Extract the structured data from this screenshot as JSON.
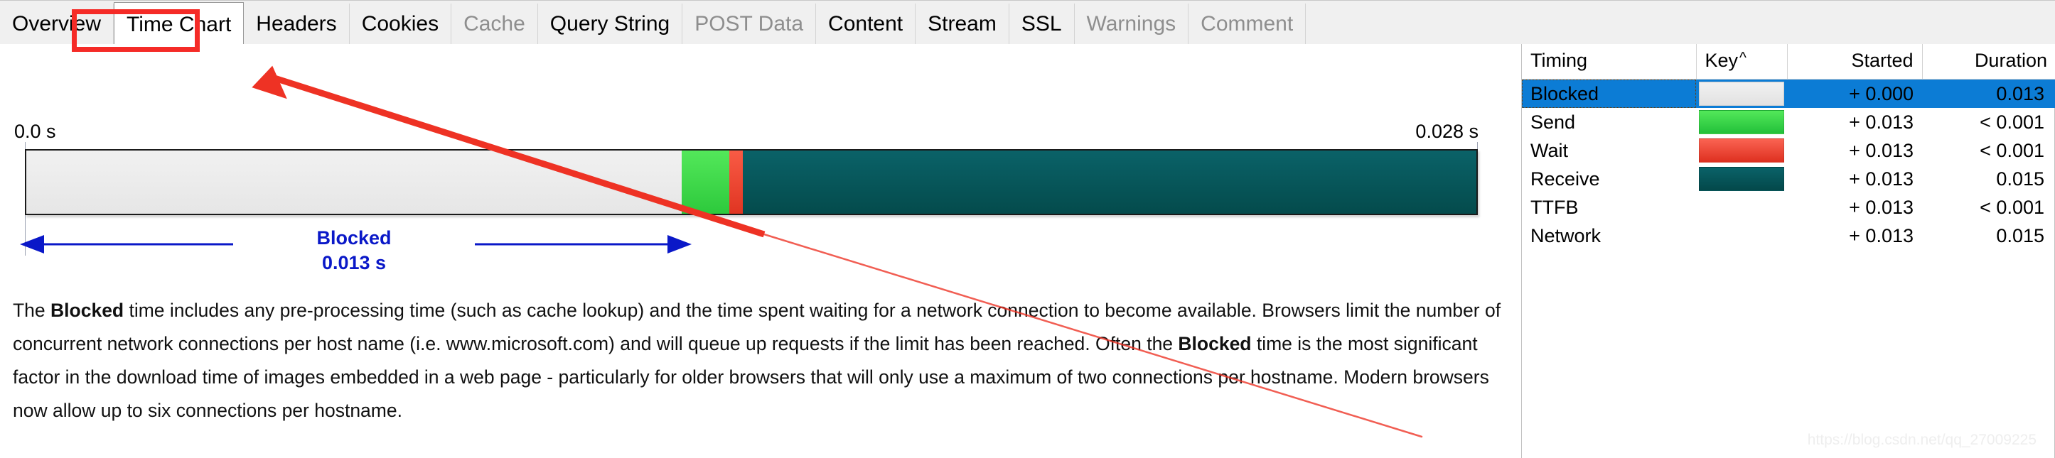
{
  "tabs": [
    {
      "label": "Overview",
      "selected": false,
      "disabled": false
    },
    {
      "label": "Time Chart",
      "selected": true,
      "disabled": false
    },
    {
      "label": "Headers",
      "selected": false,
      "disabled": false
    },
    {
      "label": "Cookies",
      "selected": false,
      "disabled": false
    },
    {
      "label": "Cache",
      "selected": false,
      "disabled": true
    },
    {
      "label": "Query String",
      "selected": false,
      "disabled": false
    },
    {
      "label": "POST Data",
      "selected": false,
      "disabled": true
    },
    {
      "label": "Content",
      "selected": false,
      "disabled": false
    },
    {
      "label": "Stream",
      "selected": false,
      "disabled": false
    },
    {
      "label": "SSL",
      "selected": false,
      "disabled": false
    },
    {
      "label": "Warnings",
      "selected": false,
      "disabled": true
    },
    {
      "label": "Comment",
      "selected": false,
      "disabled": true
    }
  ],
  "timeline": {
    "axis_start_label": "0.0 s",
    "axis_end_label": "0.028 s",
    "annotation": {
      "label": "Blocked",
      "value": "0.013 s",
      "color": "#0a18c8"
    },
    "segments": [
      {
        "name": "Blocked",
        "color": "#ebebeb",
        "percent": 45.2
      },
      {
        "name": "Send",
        "color": "#2dc93c",
        "percent": 3.3
      },
      {
        "name": "Wait",
        "color": "#e8412c",
        "percent": 0.9
      },
      {
        "name": "Receive",
        "color": "#055058",
        "percent": 50.6
      }
    ]
  },
  "description": {
    "part1": "The ",
    "bold1": "Blocked",
    "part2": " time includes any pre-processing time (such as cache lookup) and the time spent waiting for a network connection to become available. Browsers limit the number of concurrent network connections per host name (i.e. www.microsoft.com) and will queue up requests if the limit has been reached. Often the ",
    "bold2": "Blocked",
    "part3": " time is the most significant factor in the download time of images embedded in a web page - particularly for older browsers that will only use a maximum of two connections per hostname. Modern browsers now allow up to six connections per hostname."
  },
  "timing_table": {
    "columns": {
      "timing": "Timing",
      "key": "Key",
      "key_sort_caret": "^",
      "started": "Started",
      "duration": "Duration"
    },
    "rows": [
      {
        "timing": "Blocked",
        "swatch": "blocked",
        "started": "+ 0.000",
        "duration": "0.013",
        "selected": true
      },
      {
        "timing": "Send",
        "swatch": "send",
        "started": "+ 0.013",
        "duration": "< 0.001",
        "selected": false
      },
      {
        "timing": "Wait",
        "swatch": "wait",
        "started": "+ 0.013",
        "duration": "< 0.001",
        "selected": false
      },
      {
        "timing": "Receive",
        "swatch": "receive",
        "started": "+ 0.013",
        "duration": "0.015",
        "selected": false
      },
      {
        "timing": "TTFB",
        "swatch": "none",
        "started": "+ 0.013",
        "duration": "< 0.001",
        "selected": false
      },
      {
        "timing": "Network",
        "swatch": "none",
        "started": "+ 0.013",
        "duration": "0.015",
        "selected": false
      }
    ]
  },
  "annotation_overlay": {
    "arrow_color": "#ee3224",
    "highlight_color": "#f52b27"
  },
  "watermark": "https://blog.csdn.net/qq_27009225"
}
